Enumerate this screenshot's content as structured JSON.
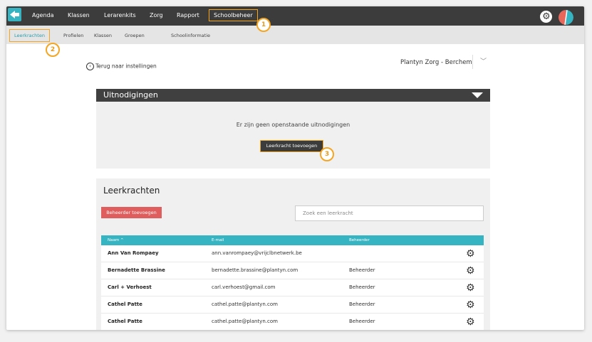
{
  "topnav": {
    "items": [
      "Agenda",
      "Klassen",
      "Lerarenkits",
      "Zorg",
      "Rapport",
      "Schoolbeheer"
    ],
    "active": "Schoolbeheer",
    "settings_icon": "gear-icon",
    "avatar_icon": "profile-avatar"
  },
  "subnav": {
    "items": [
      "Leerkrachten",
      "Profielen",
      "Klassen",
      "Groepen",
      "Schoolinformatie"
    ],
    "active": "Leerkrachten"
  },
  "callouts": [
    "1",
    "2",
    "3"
  ],
  "back_link": "Terug naar instellingen",
  "school_selector": {
    "value": "Plantyn Zorg - Berchem"
  },
  "invitations": {
    "title": "Uitnodigingen",
    "empty_text": "Er zijn geen openstaande uitnodigingen",
    "add_button": "Leerkracht toevoegen"
  },
  "teachers": {
    "title": "Leerkrachten",
    "add_admin_button": "Beheerder toevoegen",
    "search_placeholder": "Zoek een leerkracht",
    "columns": [
      "Naam ^",
      "E-mail",
      "Beheerder"
    ],
    "rows": [
      {
        "name": "Ann Van Rompaey",
        "email": "ann.vanrompaey@vrijclbnetwerk.be",
        "admin": ""
      },
      {
        "name": "Bernadette Brassine",
        "email": "bernadette.brassine@plantyn.com",
        "admin": "Beheerder"
      },
      {
        "name": "Carl + Verhoest",
        "email": "carl.verhoest@gmail.com",
        "admin": "Beheerder"
      },
      {
        "name": "Cathel Patte",
        "email": "cathel.patte@plantyn.com",
        "admin": "Beheerder"
      },
      {
        "name": "Cathel Patte",
        "email": "cathel.patte@plantyn.com",
        "admin": "Beheerder"
      }
    ]
  },
  "colors": {
    "topbar": "#3c3c3c",
    "accent_teal": "#36b4c2",
    "highlight_orange": "#f4a623",
    "danger_red": "#e05d5d"
  }
}
